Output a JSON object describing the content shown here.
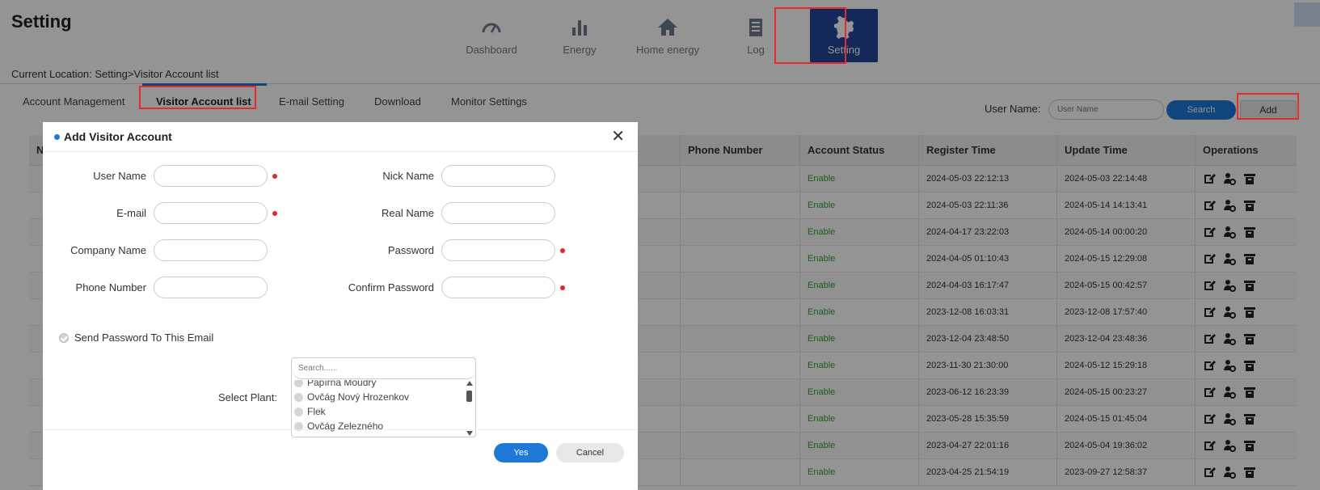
{
  "page": {
    "title": "Setting",
    "breadcrumb": "Current Location: Setting>Visitor Account list"
  },
  "nav": [
    {
      "label": "Dashboard",
      "icon": "gauge-icon"
    },
    {
      "label": "Energy",
      "icon": "bar-chart-icon"
    },
    {
      "label": "Home energy",
      "icon": "home-icon"
    },
    {
      "label": "Log",
      "icon": "log-icon"
    },
    {
      "label": "Setting",
      "icon": "gear-icon",
      "active": true
    }
  ],
  "tabs": [
    "Account Management",
    "Visitor Account list",
    "E-mail Setting",
    "Download",
    "Monitor Settings"
  ],
  "search": {
    "label": "User Name:",
    "placeholder": "User Name",
    "button": "Search",
    "add": "Add"
  },
  "table": {
    "headers": [
      "N",
      "Phone Number",
      "Account Status",
      "Register Time",
      "Update Time",
      "Operations"
    ],
    "rows": [
      {
        "status": "Enable",
        "register": "2024-05-03 22:12:13",
        "update": "2024-05-03 22:14:48"
      },
      {
        "status": "Enable",
        "register": "2024-05-03 22:11:36",
        "update": "2024-05-14 14:13:41"
      },
      {
        "status": "Enable",
        "register": "2024-04-17 23:22:03",
        "update": "2024-05-14 00:00:20"
      },
      {
        "status": "Enable",
        "register": "2024-04-05 01:10:43",
        "update": "2024-05-15 12:29:08"
      },
      {
        "status": "Enable",
        "register": "2024-04-03 16:17:47",
        "update": "2024-05-15 00:42:57"
      },
      {
        "status": "Enable",
        "register": "2023-12-08 16:03:31",
        "update": "2023-12-08 17:57:40"
      },
      {
        "status": "Enable",
        "register": "2023-12-04 23:48:50",
        "update": "2023-12-04 23:48:36"
      },
      {
        "status": "Enable",
        "register": "2023-11-30 21:30:00",
        "update": "2024-05-12 15:29:18"
      },
      {
        "status": "Enable",
        "register": "2023-06-12 16:23:39",
        "update": "2024-05-15 00:23:27"
      },
      {
        "status": "Enable",
        "register": "2023-05-28 15:35:59",
        "update": "2024-05-15 01:45:04"
      },
      {
        "status": "Enable",
        "register": "2023-04-27 22:01:16",
        "update": "2024-05-04 19:36:02"
      },
      {
        "status": "Enable",
        "register": "2023-04-25 21:54:19",
        "update": "2023-09-27 12:58:37"
      }
    ]
  },
  "modal": {
    "title": "Add Visitor Account",
    "fields": {
      "user_name": "User Name",
      "nick_name": "Nick Name",
      "email": "E-mail",
      "real_name": "Real Name",
      "company_name": "Company Name",
      "password": "Password",
      "phone_number": "Phone Number",
      "confirm_password": "Confirm Password"
    },
    "send_password": "Send Password To This Email",
    "select_plant": {
      "label": "Select Plant:",
      "placeholder": "Search......",
      "items": [
        "Papírna Moudrý",
        "Ovčág Nový Hrozenkov",
        "Flek",
        "Ovčág Zelezného"
      ]
    },
    "yes": "Yes",
    "cancel": "Cancel"
  },
  "colors": {
    "accent": "#1e78d7",
    "nav_active": "#23469a",
    "highlight": "#e52b2b",
    "enable": "#2e9f2e",
    "required": "#e0282a"
  }
}
